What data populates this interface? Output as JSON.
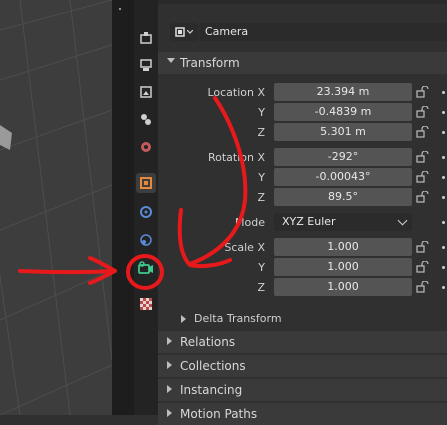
{
  "object": {
    "type_icon": "camera-icon",
    "name": "Camera"
  },
  "transform": {
    "title": "Transform",
    "location_label": "Location X",
    "y_label": "Y",
    "z_label": "Z",
    "location": {
      "x": "23.394 m",
      "y": "-0.4839 m",
      "z": "5.301 m"
    },
    "rotation_label": "Rotation X",
    "rotation": {
      "x": "-292°",
      "y": "-0.00043°",
      "z": "89.5°"
    },
    "mode_label": "Mode",
    "mode_value": "XYZ Euler",
    "scale_label": "Scale X",
    "scale": {
      "x": "1.000",
      "y": "1.000",
      "z": "1.000"
    },
    "delta": "Delta Transform"
  },
  "sections": [
    "Relations",
    "Collections",
    "Instancing",
    "Motion Paths"
  ],
  "tabs": [
    "tool-icon",
    "render-icon",
    "output-icon",
    "view-layer-icon",
    "scene-icon",
    "world-icon",
    "object-icon",
    "modifier-icon",
    "physics-icon",
    "object-data-camera-icon",
    "texture-icon"
  ],
  "colors": {
    "accent_orange": "#e8883a",
    "camera_green": "#40c98f",
    "annotation_red": "#e8191b"
  }
}
